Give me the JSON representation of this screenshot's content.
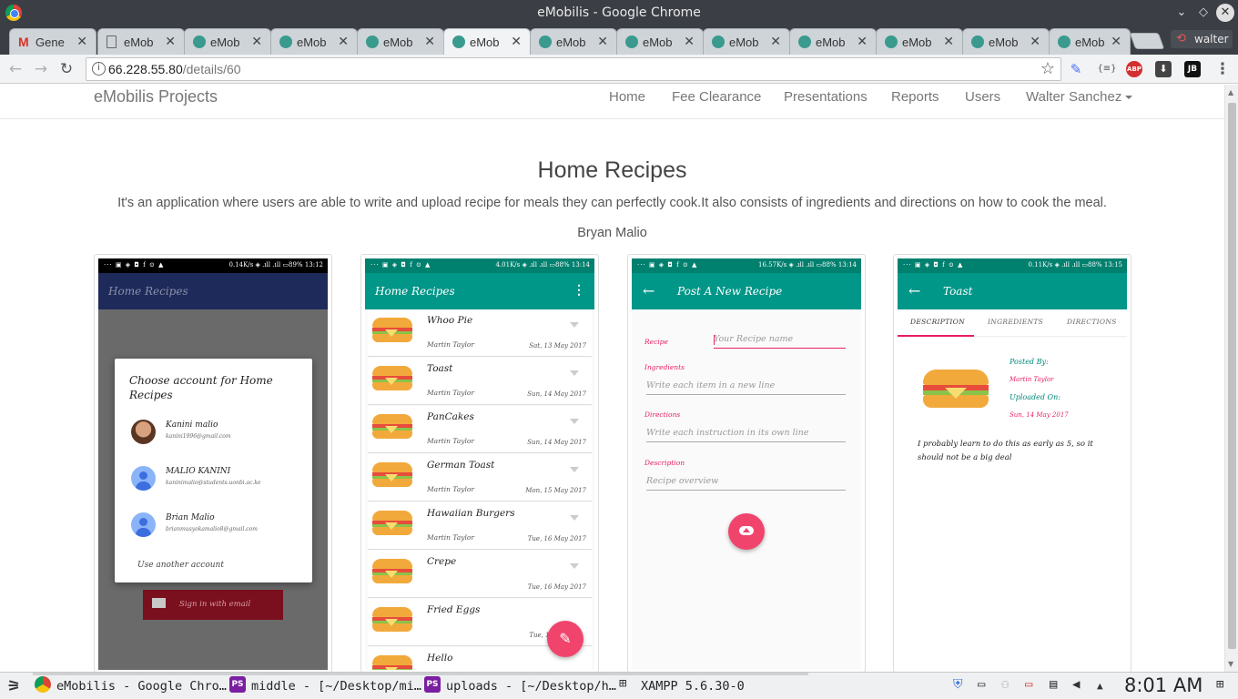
{
  "window": {
    "title": "eMobilis - Google Chrome"
  },
  "tabs": [
    {
      "label": "Gene",
      "icon": "gmail-icon"
    },
    {
      "label": "eMob",
      "icon": "doc-icon"
    },
    {
      "label": "eMob",
      "icon": "site-icon"
    },
    {
      "label": "eMob",
      "icon": "site-icon"
    },
    {
      "label": "eMob",
      "icon": "site-icon"
    },
    {
      "label": "eMob",
      "icon": "site-icon",
      "active": true
    },
    {
      "label": "eMob",
      "icon": "site-icon"
    },
    {
      "label": "eMob",
      "icon": "site-icon"
    },
    {
      "label": "eMob",
      "icon": "site-icon"
    },
    {
      "label": "eMob",
      "icon": "site-icon"
    },
    {
      "label": "eMob",
      "icon": "site-icon"
    },
    {
      "label": "eMob",
      "icon": "site-icon"
    },
    {
      "label": "eMob",
      "icon": "site-icon"
    }
  ],
  "profile": {
    "name": "walter"
  },
  "address": {
    "host": "66.228.55.80",
    "path": "/details/60"
  },
  "extensions": [
    "eyedropper-icon",
    "json-icon",
    "ABP",
    "download-icon",
    "JB"
  ],
  "site": {
    "brand": "eMobilis Projects",
    "nav": [
      "Home",
      "Fee Clearance",
      "Presentations",
      "Reports",
      "Users"
    ],
    "user_menu": "Walter Sanchez"
  },
  "project": {
    "title": "Home Recipes",
    "description": "It's an application where users are able to write and upload recipe for meals they can perfectly cook.It also consists of ingredients and directions on how to cook the meal.",
    "author": "Bryan Malio"
  },
  "screens": {
    "s1": {
      "status_left": "··· ▣ ◈ ◘ f ⊙ ▲",
      "status_right": "0.14K/s  ◈ .ıll .ıll  ▭89%  13:12",
      "appbar_title": "Home Recipes",
      "dialog_title": "Choose account for Home Recipes",
      "accounts": [
        {
          "name": "Kanini malio",
          "email": "kanini1996@gmail.com"
        },
        {
          "name": "MALIO KANINI",
          "email": "kaninimalio@students.uonbi.ac.ke"
        },
        {
          "name": "Brian Malio",
          "email": "brianmusyokamalio8@gmail.com"
        }
      ],
      "use_another": "Use another account",
      "signin_label": "Sign in with email"
    },
    "s2": {
      "status_left": "··· ▣ ◈ ◘ f ⊙ ▲",
      "status_right": "4.01K/s  ◈ .ıll .ıll  ▭88%  13:14",
      "appbar_title": "Home Recipes",
      "recipes": [
        {
          "name": "Whoo Pie",
          "author": "Martin Taylor",
          "date": "Sat, 13 May 2017"
        },
        {
          "name": "Toast",
          "author": "Martin Taylor",
          "date": "Sun, 14 May 2017"
        },
        {
          "name": "PanCakes",
          "author": "Martin Taylor",
          "date": "Sun, 14 May 2017"
        },
        {
          "name": "German Toast",
          "author": "Martin Taylor",
          "date": "Mon, 15 May 2017"
        },
        {
          "name": "Hawaiian Burgers",
          "author": "Martin Taylor",
          "date": "Tue, 16 May 2017"
        },
        {
          "name": "Crepe",
          "author": "",
          "date": "Tue, 16 May 2017"
        },
        {
          "name": "Fried Eggs",
          "author": "",
          "date": "Tue, 16"
        },
        {
          "name": "Hello",
          "author": "",
          "date": ""
        }
      ]
    },
    "s3": {
      "status_left": "··· ▣ ◈ ◘ f ⊙ ▲",
      "status_right": "16.57K/s  ◈ .ıll .ıll  ▭88%  13:14",
      "appbar_title": "Post A New Recipe",
      "recipe_label": "Recipe",
      "recipe_placeholder": "Your Recipe name",
      "ingredients_label": "Ingredients",
      "ingredients_placeholder": "Write each item in a new line",
      "directions_label": "Directions",
      "directions_placeholder": "Write each instruction in its own line",
      "description_label": "Description",
      "description_placeholder": "Recipe overview"
    },
    "s4": {
      "status_left": "··· ▣ ◈ ◘ f ⊙ ▲",
      "status_right": "0.11K/s  ◈ .ıll .ıll  ▭88%  13:15",
      "appbar_title": "Toast",
      "tabs": [
        "DESCRIPTION",
        "INGREDIENTS",
        "DIRECTIONS"
      ],
      "posted_by_label": "Posted By:",
      "posted_by": "Martin Taylor",
      "uploaded_on_label": "Uploaded On:",
      "uploaded_on": "Sun, 14 May 2017",
      "description": "I probably learn to do this as early as 5, so it should not be a big deal"
    }
  },
  "taskbar": {
    "items": [
      {
        "label": "eMobilis - Google Chro…",
        "icon": "chrome-icon"
      },
      {
        "label": "middle - [~/Desktop/mi…",
        "icon": "phpstorm-icon"
      },
      {
        "label": "uploads - [~/Desktop/h…",
        "icon": "phpstorm-icon"
      },
      {
        "label": "XAMPP 5.6.30-0",
        "icon": "network-icon"
      }
    ],
    "clock": "8:01 AM"
  },
  "colors": {
    "teal": "#009688",
    "pink": "#f0446d",
    "navy": "#1e2a5a"
  }
}
